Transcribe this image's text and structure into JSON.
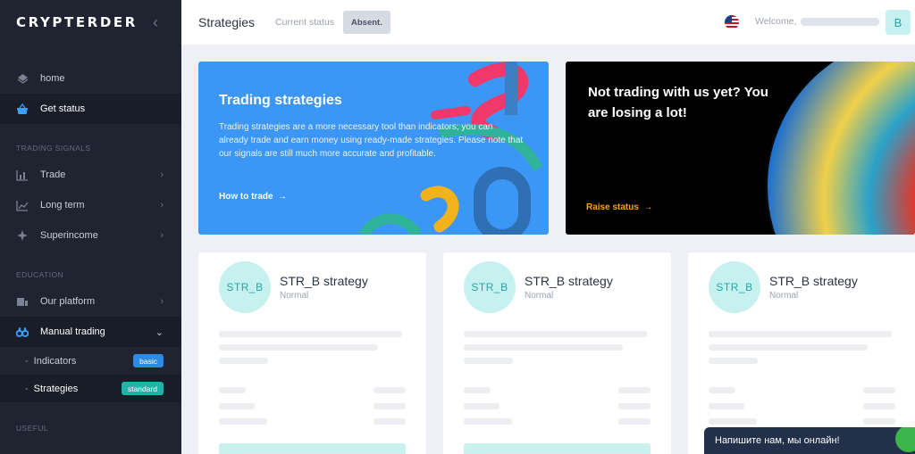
{
  "sidebar": {
    "logo": "CRYPTERDER",
    "collapse_icon": "chevrons-left-icon",
    "items_top": [
      {
        "label": "home",
        "icon": "diamond-icon"
      },
      {
        "label": "Get status",
        "icon": "basket-icon"
      }
    ],
    "section_trading": "TRADING SIGNALS",
    "trading": [
      {
        "label": "Trade",
        "icon": "bar-chart-icon"
      },
      {
        "label": "Long term",
        "icon": "line-chart-icon"
      },
      {
        "label": "Superincome",
        "icon": "sparkle-icon"
      }
    ],
    "section_education": "EDUCATION",
    "education": [
      {
        "label": "Our platform",
        "icon": "stack-icon"
      },
      {
        "label": "Manual trading",
        "icon": "binoculars-icon"
      }
    ],
    "sub": [
      {
        "label": "Indicators",
        "badge": "basic"
      },
      {
        "label": "Strategies",
        "badge": "standard"
      }
    ],
    "section_useful": "USEFUL"
  },
  "topbar": {
    "title": "Strategies",
    "current_status_label": "Current status",
    "status_value": "Absent.",
    "welcome": "Welcome,",
    "avatar_letter": "B"
  },
  "promo_trading": {
    "title": "Trading strategies",
    "description": "Trading strategies are a more necessary tool than indicators; you can already trade and earn money using ready-made strategies. Please note that our signals are still much more accurate and profitable.",
    "link": "How to trade"
  },
  "promo_status": {
    "title": "Not trading with us yet? You are losing a lot!",
    "link": "Raise status"
  },
  "cards": [
    {
      "avatar": "STR_B",
      "name": "STR_B strategy",
      "level": "Normal"
    },
    {
      "avatar": "STR_B",
      "name": "STR_B strategy",
      "level": "Normal"
    },
    {
      "avatar": "STR_B",
      "name": "STR_B strategy",
      "level": "Normal"
    }
  ],
  "chat": {
    "label": "Напишите нам, мы онлайн!"
  },
  "colors": {
    "sidebar": "#1f2430",
    "accent_blue": "#3b96f5",
    "teal": "#1fb5a6",
    "orange": "#ff9f1a"
  }
}
